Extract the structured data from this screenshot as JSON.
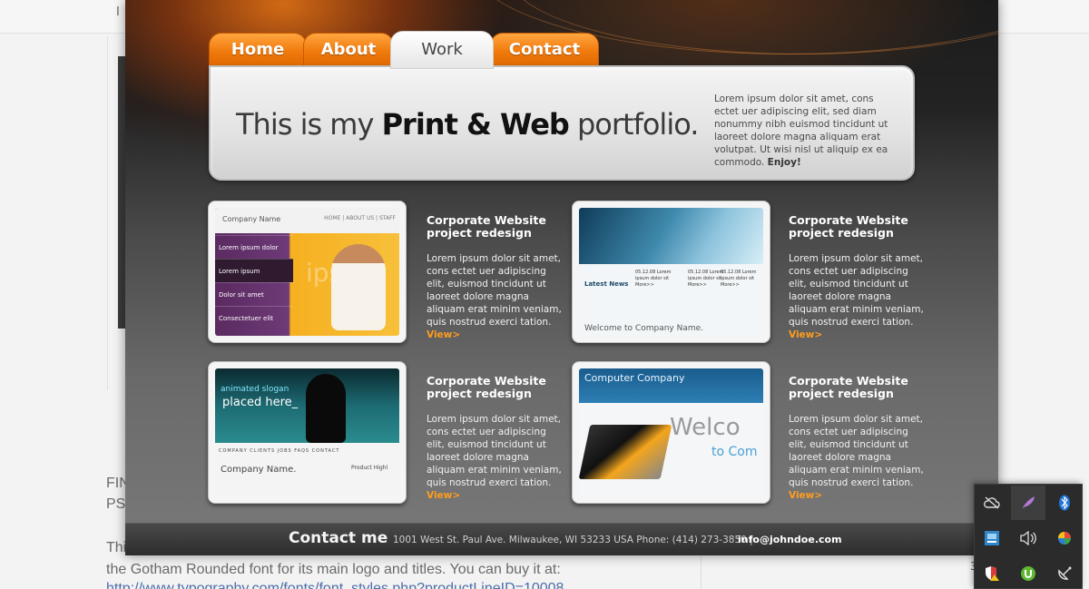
{
  "background_page": {
    "topbar_fragment": "I",
    "line1": "FIN",
    "line2": "PS",
    "paragraph": "Thi\nthe Gotham Rounded font for its main logo and titles. You can buy it at:",
    "link": "http://www.typography.com/fonts/font_styles.php?productLineID=10008",
    "right_number": "3"
  },
  "nav": {
    "tabs": [
      {
        "label": "Home"
      },
      {
        "label": "About"
      },
      {
        "label": "Work"
      },
      {
        "label": "Contact"
      }
    ],
    "active": "Work"
  },
  "hero": {
    "title_pre": "This is my ",
    "title_bold": "Print & Web",
    "title_post": " portfolio.",
    "text": "Lorem ipsum dolor sit amet, cons ectet uer adipiscing elit, sed diam nonummy nibh euismod tincidunt ut laoreet dolore magna aliquam erat volutpat. Ut wisi  nisl ut aliquip ex ea commodo.",
    "enjoy": "Enjoy!"
  },
  "projects": [
    {
      "title": "Corporate Website project redesign",
      "description": "Lorem ipsum dolor sit amet, cons ectet uer adipiscing elit, euismod tincidunt ut laoreet dolore magna aliquam erat minim veniam, quis nostrud exerci tation.",
      "link": "View>",
      "thumb": {
        "logo": "Company Name",
        "nav": "HOME | ABOUT US | STAFF",
        "menu": [
          "Lorem ipsum dolor",
          "Lorem ipsum",
          "Dolor sit amet",
          "Consectetuer elit"
        ],
        "big_text": "ipsum"
      }
    },
    {
      "title": "Corporate Website project redesign",
      "description": "Lorem ipsum dolor sit amet, cons ectet uer adipiscing elit, euismod tincidunt ut laoreet dolore magna aliquam erat minim veniam, quis nostrud exerci tation.",
      "link": "View>",
      "thumb": {
        "news": "Latest News",
        "col1": "05.12.08 Lorem ipsum dolor sit More>>",
        "col2": "05.12.08 Lorem ipsum dolor sit More>>",
        "col3": "05.12.08 Lorem ipsum dolor sit More>>",
        "welcome": "Welcome to Company Name."
      }
    },
    {
      "title": "Corporate Website project redesign",
      "description": "Lorem ipsum dolor sit amet, cons ectet uer adipiscing elit, euismod tincidunt ut laoreet dolore magna aliquam erat minim veniam, quis nostrud exerci tation.",
      "link": "View>",
      "thumb": {
        "slogan": "animated slogan",
        "placed": "placed here_",
        "nav": "COMPANY  CLIENTS  JOBS  FAQS  CONTACT",
        "company": "Company Name.",
        "product": "Product Highl"
      }
    },
    {
      "title": "Corporate Website project redesign",
      "description": "Lorem ipsum dolor sit amet, cons ectet uer adipiscing elit, euismod tincidunt ut laoreet dolore magna aliquam erat minim veniam, quis nostrud exerci tation.",
      "link": "View>",
      "thumb": {
        "company": "Computer Company",
        "welcome": "Welco",
        "welcome2": "to Com"
      }
    }
  ],
  "footer": {
    "contact_label": "Contact me",
    "address": "1001 West St. Paul Ave. Milwaukee, WI  53233  USA Phone: (414) 273-3850 |",
    "email": "info@johndoe.com"
  },
  "tray": {
    "icons": [
      "cloud-off-icon",
      "feather-icon",
      "bluetooth-icon",
      "network-app-icon",
      "volume-icon",
      "color-ball-icon",
      "shield-warning-icon",
      "torrent-icon",
      "satellite-icon"
    ]
  },
  "colors": {
    "accent_orange": "#f07a0c",
    "link_orange": "#ff9d1e",
    "dark_bg": "#232323"
  }
}
